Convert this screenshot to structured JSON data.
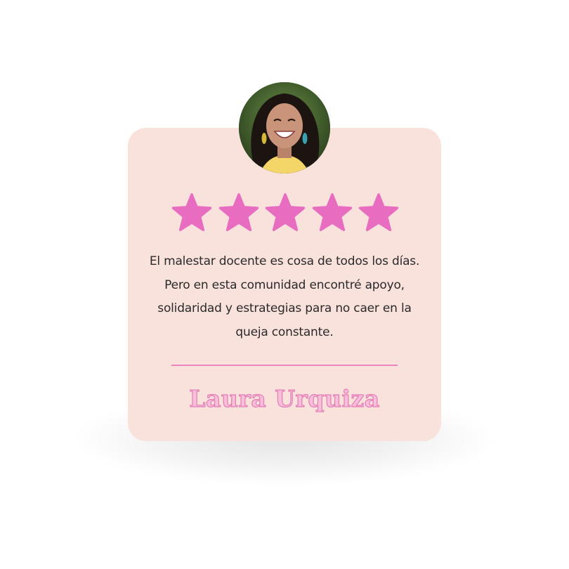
{
  "testimonial": {
    "quote": "El malestar docente es cosa de todos los días. Pero en esta comunidad encontré apoyo, solidaridad y estrategias para no caer en la queja constante.",
    "author": "Laura Urquiza",
    "rating": 5,
    "max_rating": 5
  },
  "colors": {
    "card_background": "#f9e1dc",
    "star": "#e86cc0",
    "divider": "#ec84c1",
    "name_fill": "#f7bfd9",
    "name_outline": "#e47cb5",
    "text": "#2a2a2a"
  },
  "icons": {
    "rating": "star-icon",
    "avatar": "portrait-photo"
  }
}
